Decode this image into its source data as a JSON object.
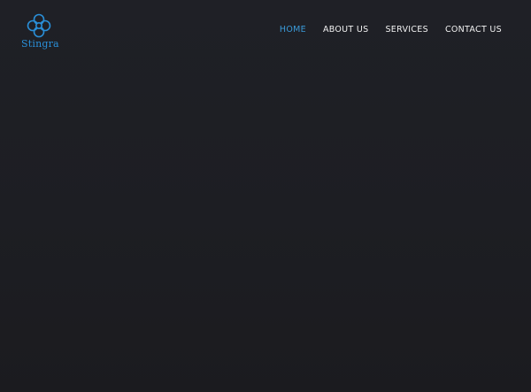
{
  "brand": {
    "name": "Stingra",
    "color": "#2a8fd8"
  },
  "nav": {
    "items": [
      {
        "label": "HOME",
        "active": true
      },
      {
        "label": "ABOUT US",
        "active": false
      },
      {
        "label": "SERVICES",
        "active": false
      },
      {
        "label": "CONTACT US",
        "active": false
      }
    ],
    "active_color": "#3a9ad9",
    "text_color": "#f2f2f2"
  },
  "theme": {
    "background": "#1f2026"
  }
}
